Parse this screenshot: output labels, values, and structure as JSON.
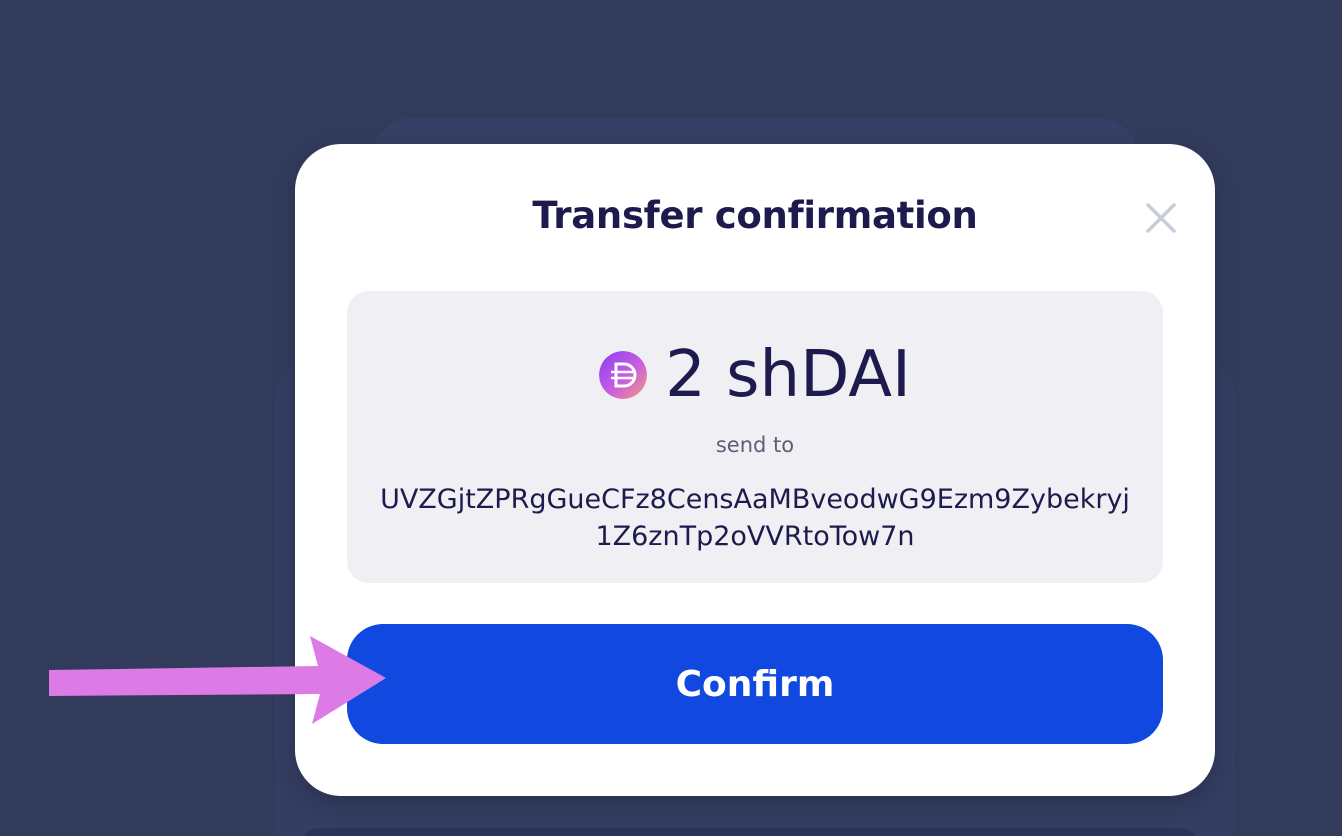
{
  "modal": {
    "title": "Transfer confirmation",
    "close_icon": "close-icon"
  },
  "transfer": {
    "token_icon": "dai-token-icon",
    "amount": "2 shDAI",
    "send_to_label": "send to",
    "address": "UVZGjtZPRgGueCFz8CensAaMBveodwG9Ezm9Zybekryj1Z6znTp2oVVRtoTow7n"
  },
  "confirm_button": {
    "label": "Confirm"
  },
  "annotation": {
    "icon": "pointer-arrow-icon",
    "color": "#dc7ae6"
  },
  "colors": {
    "backdrop": "#323b5c",
    "primary": "#1149e0",
    "text": "#1d1b4d",
    "summary_bg": "#f0f0f4"
  }
}
